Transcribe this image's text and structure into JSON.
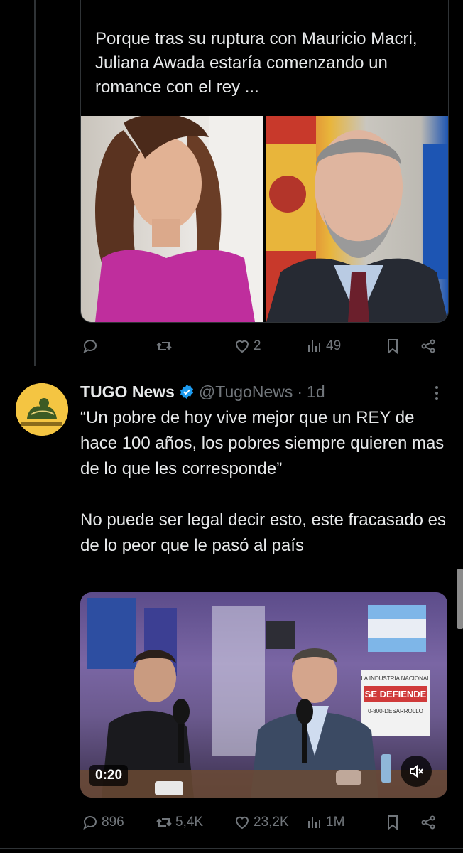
{
  "quoted_tweet": {
    "text": "Porque tras su ruptura con Mauricio Macri, Juliana Awada estaría comenzando un romance con el rey ...",
    "actions": {
      "reply_count": "",
      "retweet_count": "",
      "like_count": "2",
      "views_count": "49"
    }
  },
  "tweet": {
    "author_name": "TUGO News",
    "verified": true,
    "handle": "@TugoNews",
    "separator": "·",
    "time": "1d",
    "text": "“Un pobre de hoy vive mejor que un REY de hace 100 años, los pobres siempre quieren mas de lo que les corresponde”\n\nNo puede ser legal decir esto, este fracasado es de lo peor que le pasó al país",
    "video": {
      "duration": "0:20",
      "sign_line1": "LA INDUSTRIA NACIONAL",
      "sign_line2": "SE DEFIENDE",
      "sign_line3": "0-800-DESARROLLO"
    },
    "actions": {
      "reply_count": "896",
      "retweet_count": "5,4K",
      "like_count": "23,2K",
      "views_count": "1M"
    }
  },
  "colors": {
    "background": "#000000",
    "text": "#e7e9ea",
    "muted": "#71767b",
    "border": "#2f3336",
    "verified": "#1d9bf0"
  }
}
